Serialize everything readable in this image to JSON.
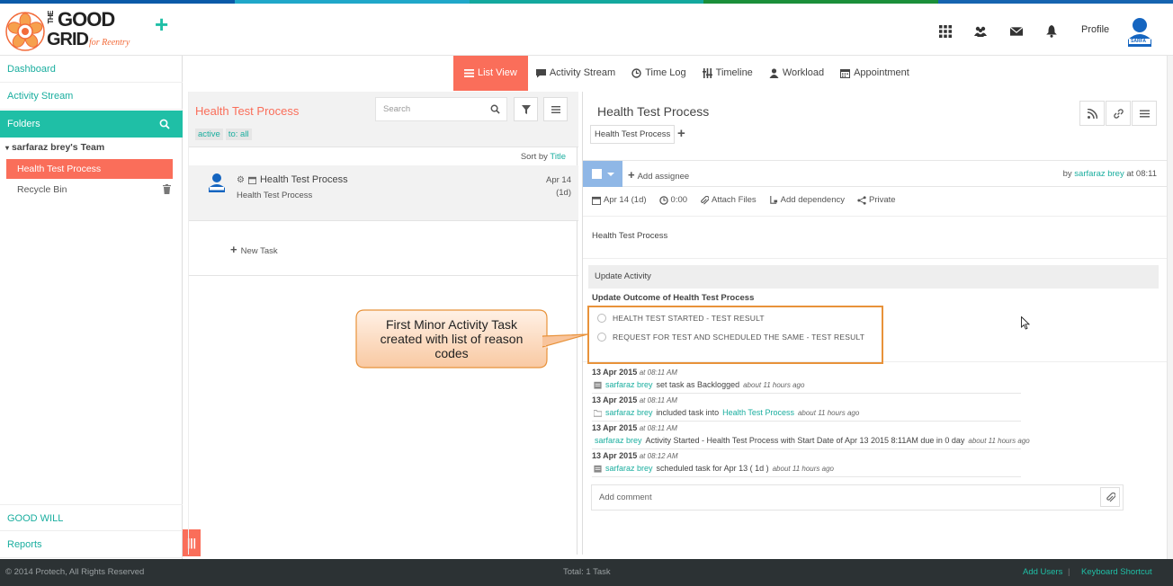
{
  "brand": {
    "logo_line1": "THE",
    "logo_line2": "GOOD",
    "logo_line3": "GRID",
    "logo_tagline": "for Reentry",
    "colors": {
      "accent": "#1fbfa6",
      "coral": "#fa6e5a",
      "footer": "#2c3234"
    }
  },
  "header": {
    "icons": [
      "apps-grid-icon",
      "users-icon",
      "mail-icon",
      "bell-icon"
    ],
    "profile_label": "Profile",
    "avatar_label": "SARFA"
  },
  "sidebar": {
    "dashboard": "Dashboard",
    "activity_stream": "Activity Stream",
    "folders": "Folders",
    "team": "sarfaraz brey's Team",
    "active_folder": "Health Test Process",
    "recycle_bin": "Recycle Bin",
    "good_will": "GOOD WILL",
    "reports": "Reports"
  },
  "tabs": [
    {
      "label": "List View",
      "icon": "list-icon",
      "active": true
    },
    {
      "label": "Activity Stream",
      "icon": "comment-icon",
      "active": false
    },
    {
      "label": "Time Log",
      "icon": "clock-icon",
      "active": false
    },
    {
      "label": "Timeline",
      "icon": "timeline-icon",
      "active": false
    },
    {
      "label": "Workload",
      "icon": "user-icon",
      "active": false
    },
    {
      "label": "Appointment",
      "icon": "calendar-icon",
      "active": false
    }
  ],
  "list": {
    "title": "Health Test Process",
    "filter_active": "active",
    "filter_to": "to: all",
    "search_placeholder": "Search",
    "sort_prefix": "Sort by",
    "sort_value": "Title",
    "task": {
      "title": "Health Test Process",
      "subtitle": "Health Test Process",
      "date": "Apr 14",
      "duration": "(1d)"
    },
    "new_task": "New Task"
  },
  "detail": {
    "title": "Health Test Process",
    "crumb": "Health Test Process",
    "add_assignee": "Add assignee",
    "by_prefix": "by",
    "by_user": "sarfaraz brey",
    "by_time": "at 08:11",
    "meta": {
      "date": "Apr 14 (1d)",
      "time": "0:00",
      "attach": "Attach Files",
      "dependency": "Add dependency",
      "privacy": "Private"
    },
    "description": "Health Test Process",
    "update_activity": "Update Activity",
    "update_outcome": "Update Outcome of Health Test Process",
    "reasons": [
      "HEALTH TEST STARTED - TEST RESULT",
      "REQUEST FOR TEST AND SCHEDULED THE SAME - TEST RESULT"
    ],
    "log": [
      {
        "date": "13 Apr 2015",
        "time": "at 08:11 AM",
        "user": "sarfaraz brey",
        "text": "set task as Backlogged",
        "link": "",
        "ago": "about 11 hours ago"
      },
      {
        "date": "13 Apr 2015",
        "time": "at 08:11 AM",
        "user": "sarfaraz brey",
        "text": "included task into",
        "link": "Health Test Process",
        "ago": "about 11 hours ago"
      },
      {
        "date": "13 Apr 2015",
        "time": "at 08:11 AM",
        "user": "sarfaraz brey",
        "text": "Activity Started - Health Test Process with Start Date of Apr 13 2015 8:11AM due in 0 day",
        "link": "",
        "ago": "about 11 hours ago"
      },
      {
        "date": "13 Apr 2015",
        "time": "at 08:12 AM",
        "user": "sarfaraz brey",
        "text": "scheduled task for Apr 13 ( 1d )",
        "link": "",
        "ago": "about 11 hours ago"
      }
    ],
    "comment_placeholder": "Add comment"
  },
  "callout": {
    "line1": "First Minor Activity Task",
    "line2": "created with list of reason",
    "line3": "codes"
  },
  "footer": {
    "copyright": "© 2014 Protech, All Rights Reserved",
    "total": "Total: 1 Task",
    "add_users": "Add Users",
    "separator": "|",
    "keyboard": "Keyboard Shortcut"
  }
}
